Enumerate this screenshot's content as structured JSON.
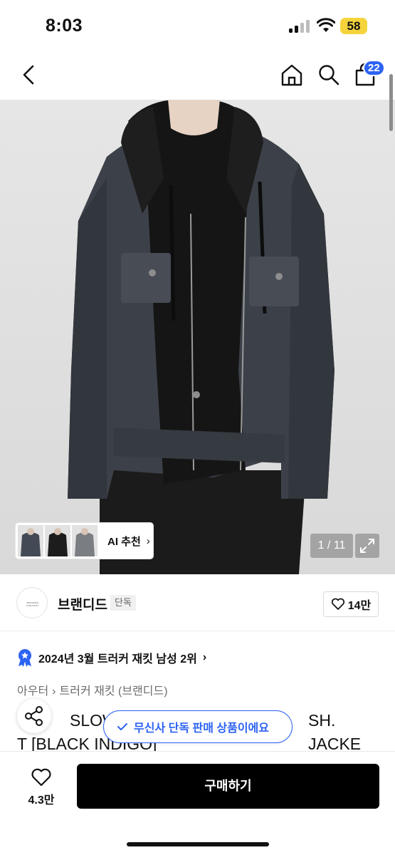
{
  "status_bar": {
    "time": "8:03",
    "battery": "58"
  },
  "nav": {
    "back_icon": "chevron-left",
    "home_icon": "home",
    "search_icon": "magnifier",
    "cart_icon": "shopping-bag",
    "cart_count": "22"
  },
  "gallery": {
    "ai_label": "AI 추천",
    "page_counter": "1 / 11",
    "expand_icon": "expand-arrows"
  },
  "brand": {
    "name": "브랜디드",
    "exclusive_tag": "단독",
    "logo_text": "BRANDED INDUSTRY",
    "like_count": "14만"
  },
  "ranking": {
    "text": "2024년 3월 트러커 재킷 남성 2위"
  },
  "breadcrumb": {
    "category": "아우터",
    "subcategory": "트러커 재킷 (브랜디드)"
  },
  "product": {
    "title_line1": "SLOW",
    "title_line1_end": "SH. JACKE",
    "title_line2": "T [BLACK INDIGO]"
  },
  "toast": {
    "text": "무신사 단독 판매 상품이에요"
  },
  "actions": {
    "like_count": "4.3만",
    "buy_label": "구매하기"
  },
  "colors": {
    "accent": "#2d63f2",
    "battery": "#f5d33b",
    "buy_button": "#000000"
  }
}
